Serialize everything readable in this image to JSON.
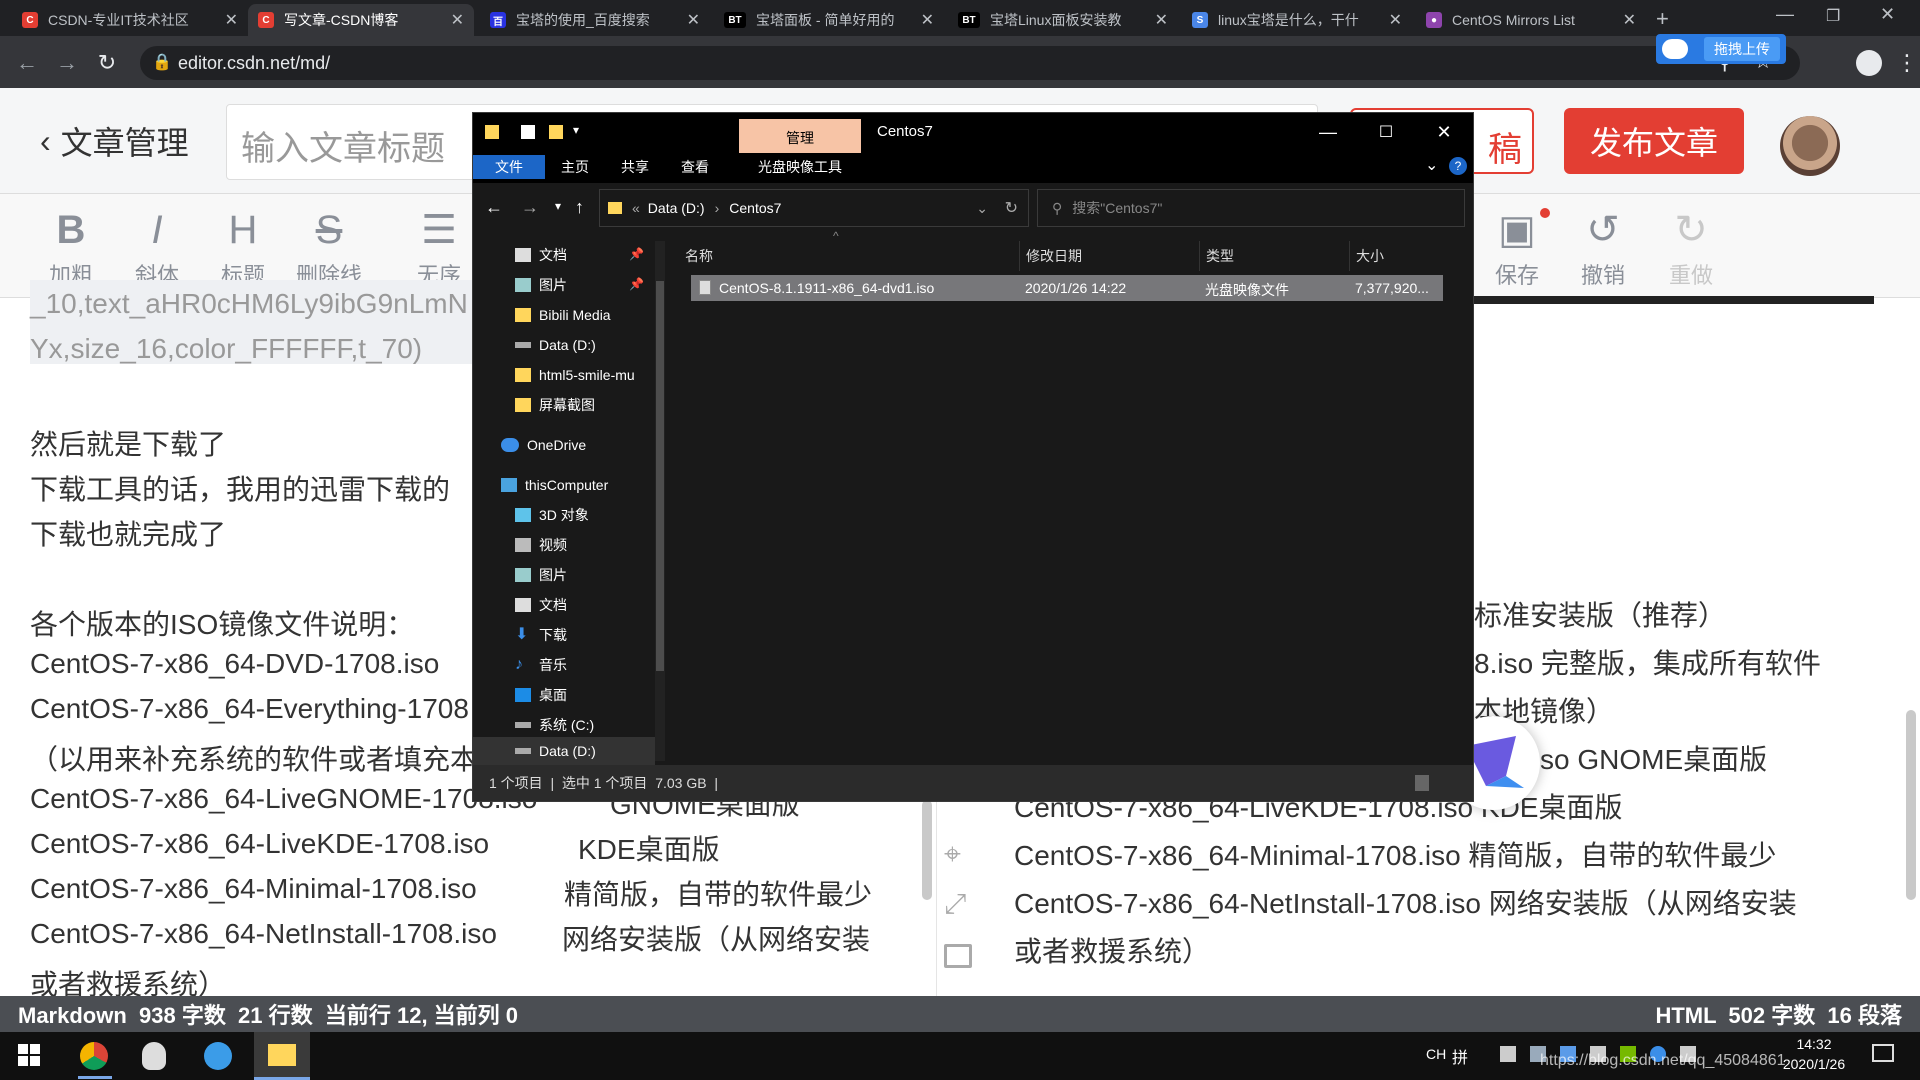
{
  "browser": {
    "tabs": [
      {
        "title": "CSDN-专业IT技术社区",
        "favicon": "C"
      },
      {
        "title": "写文章-CSDN博客",
        "favicon": "C"
      },
      {
        "title": "宝塔的使用_百度搜索",
        "favicon": "百"
      },
      {
        "title": "宝塔面板 - 简单好用的",
        "favicon": "BT"
      },
      {
        "title": "宝塔Linux面板安装教",
        "favicon": "BT"
      },
      {
        "title": "linux宝塔是什么，干什",
        "favicon": "S"
      },
      {
        "title": "CentOS Mirrors List",
        "favicon": "●"
      }
    ],
    "url": "editor.csdn.net/md/",
    "drag_upload": "拖拽上传"
  },
  "csdn": {
    "back_label": "文章管理",
    "title_placeholder": "输入文章标题",
    "draft_fragment": "稿",
    "publish_label": "发布文章",
    "toolbar": [
      "加粗",
      "斜体",
      "标题",
      "删除线",
      "无序"
    ],
    "toolbar_glyphs": [
      "B",
      "I",
      "H",
      "S",
      "☰"
    ],
    "toolbar_right": [
      "保存",
      "撤销",
      "重做"
    ],
    "left_lines": [
      "_10,text_aHR0cHM6Ly9ibG9nLmN",
      "Yx,size_16,color_FFFFFF,t_70)",
      "然后就是下载了",
      "下载工具的话，我用的迅雷下载的",
      "下载也就完成了",
      "各个版本的ISO镜像文件说明：",
      "CentOS-7-x86_64-DVD-1708.iso",
      "CentOS-7-x86_64-Everything-1708",
      "（以用来补充系统的软件或者填充本",
      "CentOS-7-x86_64-LiveGNOME-1708.iso",
      "CentOS-7-x86_64-LiveKDE-1708.iso",
      "CentOS-7-x86_64-Minimal-1708.iso",
      "CentOS-7-x86_64-NetInstall-1708.iso",
      "或者救援系统）"
    ],
    "left_desc": [
      "GNOME桌面版",
      "KDE桌面版",
      "精简版，自带的软件最少",
      "网络安装版（从网络安装"
    ],
    "right_lines": [
      "标准安装版（推荐）",
      "8.iso 完整版，集成所有软件",
      "本地镜像）",
      "so GNOME桌面版",
      "CentOS-7-x86_64-LiveKDE-1708.iso KDE桌面版",
      "CentOS-7-x86_64-Minimal-1708.iso 精简版，自带的软件最少",
      "CentOS-7-x86_64-NetInstall-1708.iso 网络安装版（从网络安装",
      "或者救援系统）"
    ],
    "status_left": "Markdown  938 字数  21 行数  当前行 12, 当前列 0",
    "status_right": "HTML  502 字数  16 段落"
  },
  "explorer": {
    "manage_tab": "管理",
    "window_title": "Centos7",
    "ribbon_tabs": [
      "文件",
      "主页",
      "共享",
      "查看",
      "光盘映像工具"
    ],
    "breadcrumb": [
      "Data (D:)",
      "Centos7"
    ],
    "search_placeholder": "搜索\"Centos7\"",
    "nav_items": [
      {
        "label": "文档",
        "icon": "document-icon",
        "pinned": true
      },
      {
        "label": "图片",
        "icon": "picture-icon",
        "pinned": true
      },
      {
        "label": "Bibili Media",
        "icon": "folder-icon"
      },
      {
        "label": "Data (D:)",
        "icon": "drive-icon"
      },
      {
        "label": "html5-smile-mu",
        "icon": "folder-icon"
      },
      {
        "label": "屏幕截图",
        "icon": "folder-icon"
      },
      {
        "label": "OneDrive",
        "icon": "cloud-icon"
      },
      {
        "label": "thisComputer",
        "icon": "computer-icon"
      },
      {
        "label": "3D 对象",
        "icon": "cube-icon"
      },
      {
        "label": "视频",
        "icon": "video-icon"
      },
      {
        "label": "图片",
        "icon": "picture-icon"
      },
      {
        "label": "文档",
        "icon": "document-icon"
      },
      {
        "label": "下载",
        "icon": "download-icon"
      },
      {
        "label": "音乐",
        "icon": "music-icon"
      },
      {
        "label": "桌面",
        "icon": "desktop-icon"
      },
      {
        "label": "系统 (C:)",
        "icon": "drive-icon"
      },
      {
        "label": "Data (D:)",
        "icon": "drive-icon"
      }
    ],
    "columns": [
      "名称",
      "修改日期",
      "类型",
      "大小"
    ],
    "files": [
      {
        "name": "CentOS-8.1.1911-x86_64-dvd1.iso",
        "date": "2020/1/26 14:22",
        "type": "光盘映像文件",
        "size": "7,377,920..."
      }
    ],
    "status": "1 个项目  |  选中 1 个项目  7.03 GB  |"
  },
  "taskbar": {
    "ime": "CH",
    "ime2": "拼",
    "time": "14:32",
    "date": "2020/1/26"
  },
  "watermark": "https://blog.csdn.net/qq_45084861",
  "colors": {
    "csdn_red": "#e33e33",
    "explorer_bg": "#191919",
    "selected": "#77777a",
    "manage_tab": "#f7c4a6"
  }
}
